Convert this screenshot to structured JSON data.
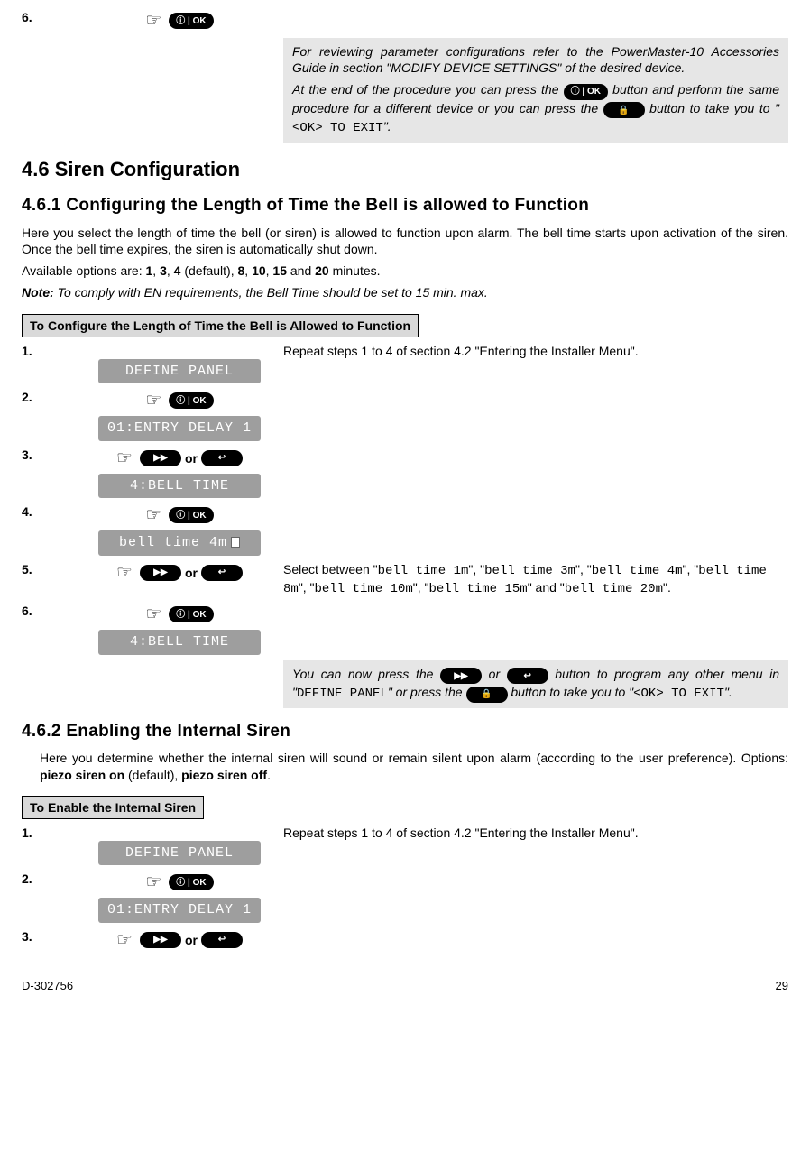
{
  "topRow": {
    "num": "6.",
    "ok": "ⓘ | OK"
  },
  "topNote": {
    "p1a": "For reviewing parameter configurations refer to the PowerMaster-10 Accessories Guide in section \"MODIFY DEVICE SETTINGS\" of the desired device.",
    "p2a": "At the end of the procedure you can press the ",
    "ok": "ⓘ | OK",
    "p2b": " button and perform the same procedure for a different device or you can press the ",
    "p2c": " button to take you to \"",
    "code": "<OK> TO EXIT",
    "p2d": "\"."
  },
  "h46": "4.6 Siren Configuration",
  "h461": "4.6.1 Configuring the Length of Time the Bell is allowed to Function",
  "p461a": "Here you select the length of time the bell (or siren) is allowed to function upon alarm. The bell time starts upon activation of the siren. Once the bell time expires, the siren is automatically shut down.",
  "p461b_a": "Available options are: ",
  "opts": {
    "o1": "1",
    "c1": ", ",
    "o2": "3",
    "c2": ", ",
    "o3": "4",
    "def": " (default), ",
    "o4": "8",
    "c3": ", ",
    "o5": "10",
    "c4": ", ",
    "o6": "15",
    "and": " and ",
    "o7": "20",
    "min": " minutes."
  },
  "noteLabel": "Note:",
  "noteText": " To comply with EN requirements, the Bell Time should be set to 15 min. max.",
  "tbl1": "To Configure the Length of Time the Bell is Allowed to Function",
  "bell": {
    "n1": "1.",
    "lcd1": "DEFINE PANEL",
    "desc1": "Repeat steps 1 to 4 of section 4.2 \"Entering the Installer Menu\".",
    "n2": "2.",
    "ok2": "ⓘ | OK",
    "lcd2": "01:ENTRY DELAY 1",
    "n3": "3.",
    "fwd3": "▶▶",
    "or3": "or",
    "back3": "↩",
    "lcd3": "4:BELL TIME",
    "n4": "4.",
    "ok4": "ⓘ | OK",
    "lcd4": "bell time 4m",
    "n5": "5.",
    "fwd5": "▶▶",
    "or5": "or",
    "back5": "↩",
    "desc5a": "Select between \"",
    "c1": "bell time 1m",
    "d5b": "\", \"",
    "c2": "bell time 3m",
    "d5c": "\", \"",
    "c3": "bell time 4m",
    "d5d": "\", \"",
    "c4": "bell time 8m",
    "d5e": "\", \"",
    "c5": "bell time 10m",
    "d5f": "\", \"",
    "c6": "bell time 15m",
    "d5g": "\" and \"",
    "c7": "bell time 20m",
    "d5h": "\".",
    "n6": "6.",
    "ok6": "ⓘ | OK",
    "lcd6": "4:BELL TIME"
  },
  "bellNote": {
    "a": "You can now press the ",
    "fwd": "▶▶",
    "b": " or ",
    "back": "↩",
    "c": " button to program any other menu in \"",
    "code1": "DEFINE PANEL",
    "d": "\" or press the ",
    "e": " button to take you to \"",
    "code2": "<OK> TO EXIT",
    "f": "\"."
  },
  "h462": "4.6.2 Enabling the Internal Siren",
  "p462a": "Here you determine whether the internal siren will sound or remain silent upon alarm (according to the user preference). Options: ",
  "p462b": "piezo siren on",
  "p462c": " (default), ",
  "p462d": "piezo siren off",
  "p462e": ".",
  "tbl2": "To Enable the Internal Siren",
  "siren": {
    "n1": "1.",
    "lcd1": "DEFINE PANEL",
    "desc1": "Repeat steps 1 to 4 of section 4.2 \"Entering the Installer Menu\".",
    "n2": "2.",
    "ok2": "ⓘ | OK",
    "lcd2": "01:ENTRY DELAY 1",
    "n3": "3.",
    "fwd3": "▶▶",
    "or3": "or",
    "back3": "↩"
  },
  "footer": {
    "left": "D-302756",
    "right": "29"
  }
}
